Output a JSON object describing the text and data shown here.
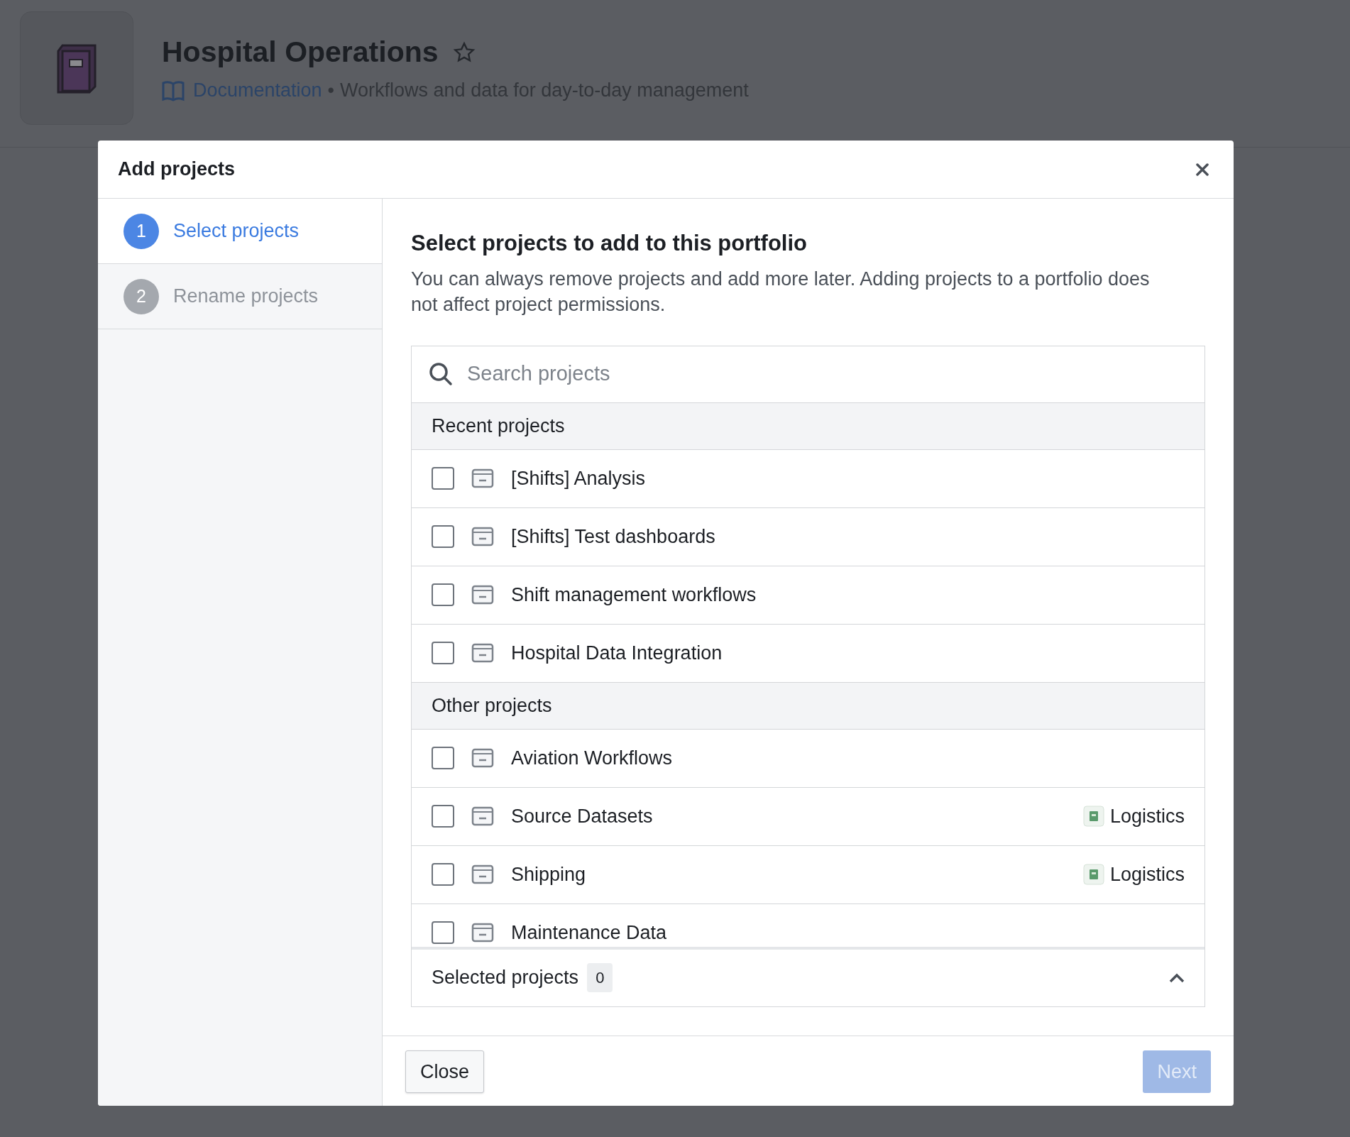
{
  "page": {
    "title": "Hospital Operations",
    "starred": false,
    "link": "Documentation",
    "separator": "•",
    "description": "Workflows and data for day-to-day management"
  },
  "dialog": {
    "title": "Add projects",
    "steps": [
      {
        "number": "1",
        "label": "Select projects",
        "selected": true
      },
      {
        "number": "2",
        "label": "Rename projects",
        "selected": false
      }
    ],
    "heading": "Select projects to add to this portfolio",
    "intro": "You can always remove projects and add more later. Adding projects to a portfolio does not affect project permissions.",
    "search": {
      "placeholder": "Search projects"
    },
    "sections": [
      {
        "title": "Recent projects",
        "items": [
          {
            "label": "[Shifts] Analysis",
            "checked": false
          },
          {
            "label": "[Shifts] Test dashboards",
            "checked": false
          },
          {
            "label": "Shift management workflows",
            "checked": false
          },
          {
            "label": "Hospital Data Integration",
            "checked": false
          }
        ]
      },
      {
        "title": "Other projects",
        "items": [
          {
            "label": "Aviation Workflows",
            "checked": false
          },
          {
            "label": "Source Datasets",
            "checked": false,
            "tag": "Logistics"
          },
          {
            "label": "Shipping",
            "checked": false,
            "tag": "Logistics"
          },
          {
            "label": "Maintenance Data",
            "checked": false
          }
        ]
      }
    ],
    "selected": {
      "label": "Selected projects",
      "count": "0",
      "expanded": false
    },
    "buttons": [
      {
        "label": "Close",
        "kind": "secondary",
        "disabled": false
      },
      {
        "label": "Next",
        "kind": "primary",
        "disabled": true
      }
    ]
  }
}
